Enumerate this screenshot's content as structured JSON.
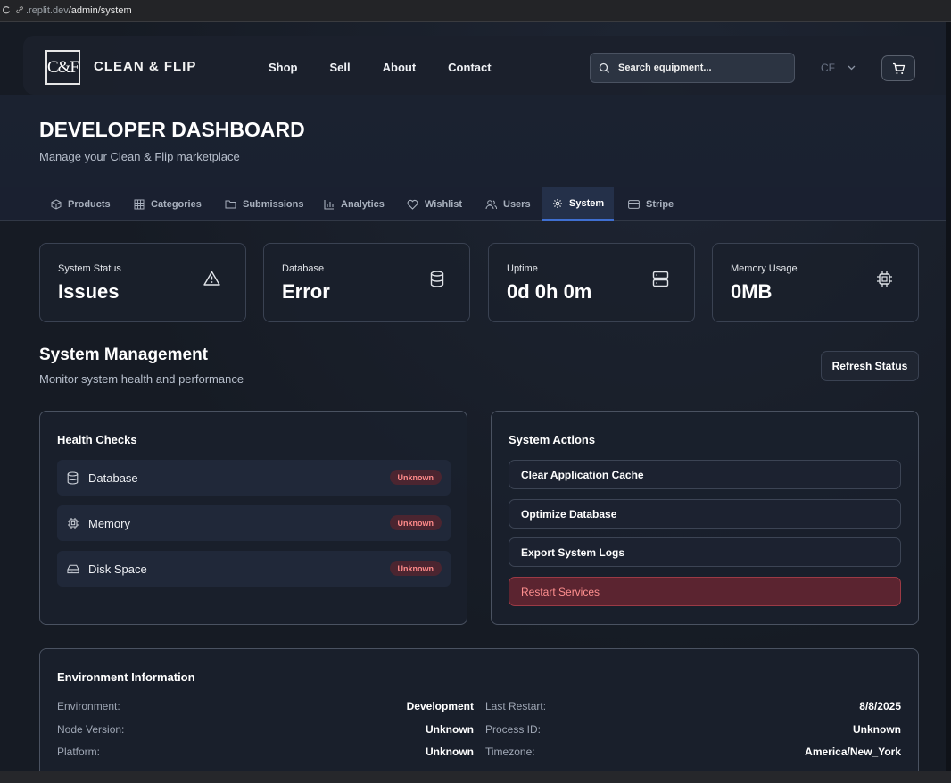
{
  "browser": {
    "url_prefix": ".replit.dev",
    "url_path": "/admin/system"
  },
  "header": {
    "logo_mark": "C&F",
    "logo_text": "CLEAN & FLIP",
    "nav": [
      "Shop",
      "Sell",
      "About",
      "Contact"
    ],
    "search_placeholder": "Search equipment...",
    "user_initials": "CF"
  },
  "hero": {
    "title": "DEVELOPER DASHBOARD",
    "subtitle": "Manage your Clean & Flip marketplace"
  },
  "tabs": [
    {
      "label": "Products",
      "icon": "box-icon"
    },
    {
      "label": "Categories",
      "icon": "grid-icon"
    },
    {
      "label": "Submissions",
      "icon": "folder-icon"
    },
    {
      "label": "Analytics",
      "icon": "bar-chart-icon"
    },
    {
      "label": "Wishlist",
      "icon": "heart-icon"
    },
    {
      "label": "Users",
      "icon": "users-icon"
    },
    {
      "label": "System",
      "icon": "gear-icon",
      "active": true
    },
    {
      "label": "Stripe",
      "icon": "credit-card-icon"
    }
  ],
  "stats": [
    {
      "label": "System Status",
      "value": "Issues",
      "icon": "alert-triangle-icon"
    },
    {
      "label": "Database",
      "value": "Error",
      "icon": "database-icon"
    },
    {
      "label": "Uptime",
      "value": "0d 0h 0m",
      "icon": "server-icon"
    },
    {
      "label": "Memory Usage",
      "value": "0MB",
      "icon": "cpu-icon"
    }
  ],
  "system_management": {
    "title": "System Management",
    "subtitle": "Monitor system health and performance",
    "refresh_label": "Refresh Status"
  },
  "health_checks": {
    "title": "Health Checks",
    "items": [
      {
        "name": "Database",
        "status": "Unknown",
        "icon": "database-icon"
      },
      {
        "name": "Memory",
        "status": "Unknown",
        "icon": "cpu-icon"
      },
      {
        "name": "Disk Space",
        "status": "Unknown",
        "icon": "hard-drive-icon"
      }
    ]
  },
  "system_actions": {
    "title": "System Actions",
    "items": [
      "Clear Application Cache",
      "Optimize Database",
      "Export System Logs",
      "Restart Services"
    ]
  },
  "environment": {
    "title": "Environment Information",
    "rows": [
      {
        "key": "Environment:",
        "value": "Development"
      },
      {
        "key": "Last Restart:",
        "value": "8/8/2025"
      },
      {
        "key": "Node Version:",
        "value": "Unknown"
      },
      {
        "key": "Process ID:",
        "value": "Unknown"
      },
      {
        "key": "Platform:",
        "value": "Unknown"
      },
      {
        "key": "Timezone:",
        "value": "America/New_York"
      }
    ]
  },
  "colors": {
    "background": "#161b24",
    "accent": "#3f6fd1",
    "danger": "#ff8f8f",
    "badge_bg": "#4b2530"
  }
}
